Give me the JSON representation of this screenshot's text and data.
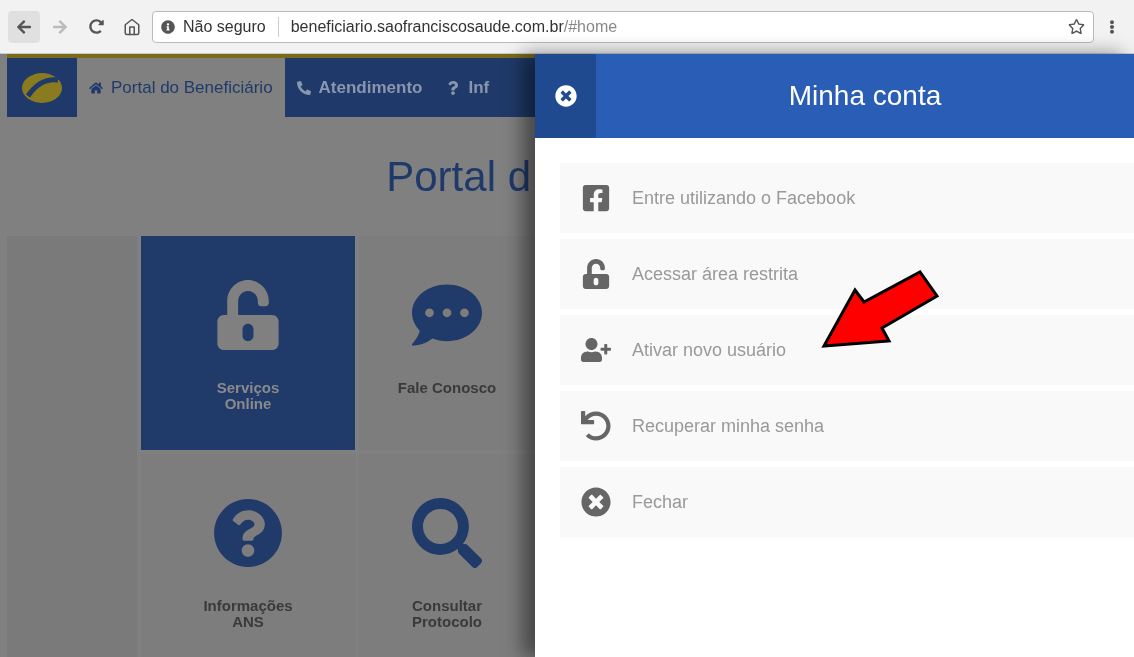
{
  "browser": {
    "back_disabled": false,
    "forward_disabled": true,
    "security": "Não seguro",
    "url_host": "beneficiario.saofranciscosaude.com.br",
    "url_path": "/#home"
  },
  "nav": [
    {
      "label": "Portal do Beneficiário",
      "kind": "home",
      "selected": true
    },
    {
      "label": "Atendimento",
      "kind": "phone",
      "selected": false
    },
    {
      "label": "Inf",
      "kind": "help",
      "selected": false
    }
  ],
  "page_title": "Portal d",
  "tiles": [
    {
      "label": "Serviços\nOnline",
      "kind": "unlock",
      "selected": true
    },
    {
      "label": "Fale Conosco",
      "kind": "chat",
      "selected": false
    },
    {
      "label": "Informações\nANS",
      "kind": "help",
      "selected": false
    },
    {
      "label": "Consultar\nProtocolo",
      "kind": "search",
      "selected": false
    }
  ],
  "panel": {
    "title": "Minha conta",
    "items": [
      {
        "label": "Entre utilizando o Facebook",
        "kind": "facebook"
      },
      {
        "label": "Acessar área restrita",
        "kind": "unlock"
      },
      {
        "label": "Ativar novo usuário",
        "kind": "user-plus"
      },
      {
        "label": "Recuperar minha senha",
        "kind": "undo"
      },
      {
        "label": "Fechar",
        "kind": "close"
      }
    ]
  }
}
